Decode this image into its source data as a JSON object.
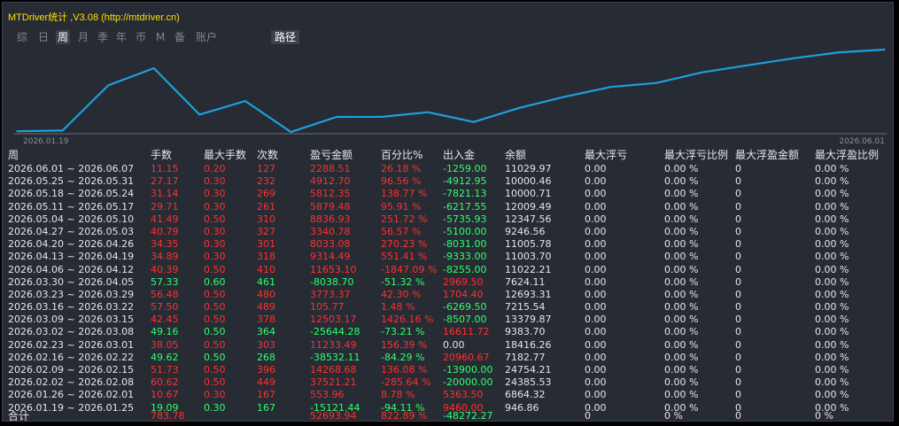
{
  "app": {
    "title": "MTDriver统计 ,V3.08 (http://mtdriver.cn)"
  },
  "tabs": [
    {
      "label": "综",
      "active": false
    },
    {
      "label": "日",
      "active": false
    },
    {
      "label": "周",
      "active": true
    },
    {
      "label": "月",
      "active": false
    },
    {
      "label": "季",
      "active": false
    },
    {
      "label": "年",
      "active": false
    },
    {
      "label": "币",
      "active": false
    },
    {
      "label": "M",
      "active": false
    },
    {
      "label": "备",
      "active": false
    },
    {
      "label": "账户",
      "active": false
    },
    {
      "label": "路径",
      "active": true
    }
  ],
  "chart_data": {
    "type": "line",
    "x_start_label": "2026.01.19",
    "x_end_label": "2026.06.01",
    "x": [
      "2026.01.19",
      "2026.01.26",
      "2026.02.02",
      "2026.02.09",
      "2026.02.16",
      "2026.02.23",
      "2026.03.02",
      "2026.03.09",
      "2026.03.16",
      "2026.03.23",
      "2026.03.30",
      "2026.04.06",
      "2026.04.13",
      "2026.04.20",
      "2026.04.27",
      "2026.05.04",
      "2026.05.11",
      "2026.05.18",
      "2026.05.25",
      "2026.06.01"
    ],
    "values": [
      -15121.44,
      -14567.48,
      22954.73,
      37223.41,
      -1308.7,
      9924.69,
      -15719.59,
      -3216.42,
      -3110.65,
      662.72,
      -7375.98,
      4277.51,
      13591.94,
      21625.02,
      24965.8,
      33802.73,
      39682.21,
      45494.56,
      50407.26,
      52693.94
    ],
    "color": "#1e9fe0"
  },
  "table": {
    "headers": [
      "周",
      "手数",
      "最大手数",
      "次数",
      "盈亏金额",
      "百分比%",
      "出入金",
      "余额",
      "最大浮亏",
      "最大浮亏比例",
      "最大浮盈金额",
      "最大浮盈比例"
    ],
    "rows": [
      [
        "2026.06.01 ~ 2026.06.07",
        "11.15",
        "0.20",
        "127",
        "2288.51",
        "26.18 %",
        "-1259.00",
        "11029.97",
        "0.00",
        "0.00 %",
        "0",
        "0.00 %"
      ],
      [
        "2026.05.25 ~ 2026.05.31",
        "27.17",
        "0.30",
        "232",
        "4912.70",
        "96.56 %",
        "-4912.95",
        "10000.46",
        "0.00",
        "0.00 %",
        "0",
        "0.00 %"
      ],
      [
        "2026.05.18 ~ 2026.05.24",
        "31.14",
        "0.30",
        "269",
        "5812.35",
        "138.77 %",
        "-7821.13",
        "10000.71",
        "0.00",
        "0.00 %",
        "0",
        "0.00 %"
      ],
      [
        "2026.05.11 ~ 2026.05.17",
        "29.71",
        "0.30",
        "261",
        "5879.48",
        "95.91 %",
        "-6217.55",
        "12009.49",
        "0.00",
        "0.00 %",
        "0",
        "0.00 %"
      ],
      [
        "2026.05.04 ~ 2026.05.10",
        "41.49",
        "0.50",
        "310",
        "8836.93",
        "251.72 %",
        "-5735.93",
        "12347.56",
        "0.00",
        "0.00 %",
        "0",
        "0.00 %"
      ],
      [
        "2026.04.27 ~ 2026.05.03",
        "40.79",
        "0.30",
        "327",
        "3340.78",
        "56.57 %",
        "-5100.00",
        "9246.56",
        "0.00",
        "0.00 %",
        "0",
        "0.00 %"
      ],
      [
        "2026.04.20 ~ 2026.04.26",
        "34.35",
        "0.30",
        "301",
        "8033.08",
        "270.23 %",
        "-8031.00",
        "11005.78",
        "0.00",
        "0.00 %",
        "0",
        "0.00 %"
      ],
      [
        "2026.04.13 ~ 2026.04.19",
        "34.89",
        "0.30",
        "318",
        "9314.49",
        "551.41 %",
        "-9333.00",
        "11003.70",
        "0.00",
        "0.00 %",
        "0",
        "0.00 %"
      ],
      [
        "2026.04.06 ~ 2026.04.12",
        "40.39",
        "0.50",
        "410",
        "11653.10",
        "-1847.09 %",
        "-8255.00",
        "11022.21",
        "0.00",
        "0.00 %",
        "0",
        "0.00 %"
      ],
      [
        "2026.03.30 ~ 2026.04.05",
        "57.33",
        "0.60",
        "461",
        "-8038.70",
        "-51.32 %",
        "2969.50",
        "7624.11",
        "0.00",
        "0.00 %",
        "0",
        "0.00 %"
      ],
      [
        "2026.03.23 ~ 2026.03.29",
        "56.48",
        "0.50",
        "480",
        "3773.37",
        "42.30 %",
        "1704.40",
        "12693.31",
        "0.00",
        "0.00 %",
        "0",
        "0.00 %"
      ],
      [
        "2026.03.16 ~ 2026.03.22",
        "57.50",
        "0.50",
        "489",
        "105.77",
        "1.48 %",
        "-6269.50",
        "7215.54",
        "0.00",
        "0.00 %",
        "0",
        "0.00 %"
      ],
      [
        "2026.03.09 ~ 2026.03.15",
        "42.45",
        "0.50",
        "378",
        "12503.17",
        "1426.16 %",
        "-8507.00",
        "13379.87",
        "0.00",
        "0.00 %",
        "0",
        "0.00 %"
      ],
      [
        "2026.03.02 ~ 2026.03.08",
        "49.16",
        "0.50",
        "364",
        "-25644.28",
        "-73.21 %",
        "16611.72",
        "9383.70",
        "0.00",
        "0.00 %",
        "0",
        "0.00 %"
      ],
      [
        "2026.02.23 ~ 2026.03.01",
        "38.05",
        "0.50",
        "303",
        "11233.49",
        "156.39 %",
        "0.00",
        "18416.26",
        "0.00",
        "0.00 %",
        "0",
        "0.00 %"
      ],
      [
        "2026.02.16 ~ 2026.02.22",
        "49.62",
        "0.50",
        "268",
        "-38532.11",
        "-84.29 %",
        "20960.67",
        "7182.77",
        "0.00",
        "0.00 %",
        "0",
        "0.00 %"
      ],
      [
        "2026.02.09 ~ 2026.02.15",
        "51.73",
        "0.50",
        "396",
        "14268.68",
        "136.08 %",
        "-13900.00",
        "24754.21",
        "0.00",
        "0.00 %",
        "0",
        "0.00 %"
      ],
      [
        "2026.02.02 ~ 2026.02.08",
        "60.62",
        "0.50",
        "449",
        "37521.21",
        "-285.64 %",
        "-20000.00",
        "24385.53",
        "0.00",
        "0.00 %",
        "0",
        "0.00 %"
      ],
      [
        "2026.01.26 ~ 2026.02.01",
        "10.67",
        "0.30",
        "167",
        "553.96",
        "8.78 %",
        "5363.50",
        "6864.32",
        "0.00",
        "0.00 %",
        "0",
        "0.00 %"
      ],
      [
        "2026.01.19 ~ 2026.01.25",
        "19.09",
        "0.30",
        "167",
        "-15121.44",
        "-94.11 %",
        "9460.00",
        "946.86",
        "0.00",
        "0.00 %",
        "0",
        "0.00 %"
      ]
    ],
    "total": {
      "label": "合计",
      "lots": "783.78",
      "pnl": "52693.94",
      "pct": "822.89 %",
      "flow": "-48272.27",
      "max_dd": "0",
      "max_dd_pct": "0 %",
      "max_fp": "0",
      "max_fp_pct": "0 %"
    }
  },
  "colors": {
    "title": "#ffe000",
    "positive": "#ff3030",
    "negative": "#30ff70",
    "text": "#e6e6e6",
    "line": "#1e9fe0"
  }
}
